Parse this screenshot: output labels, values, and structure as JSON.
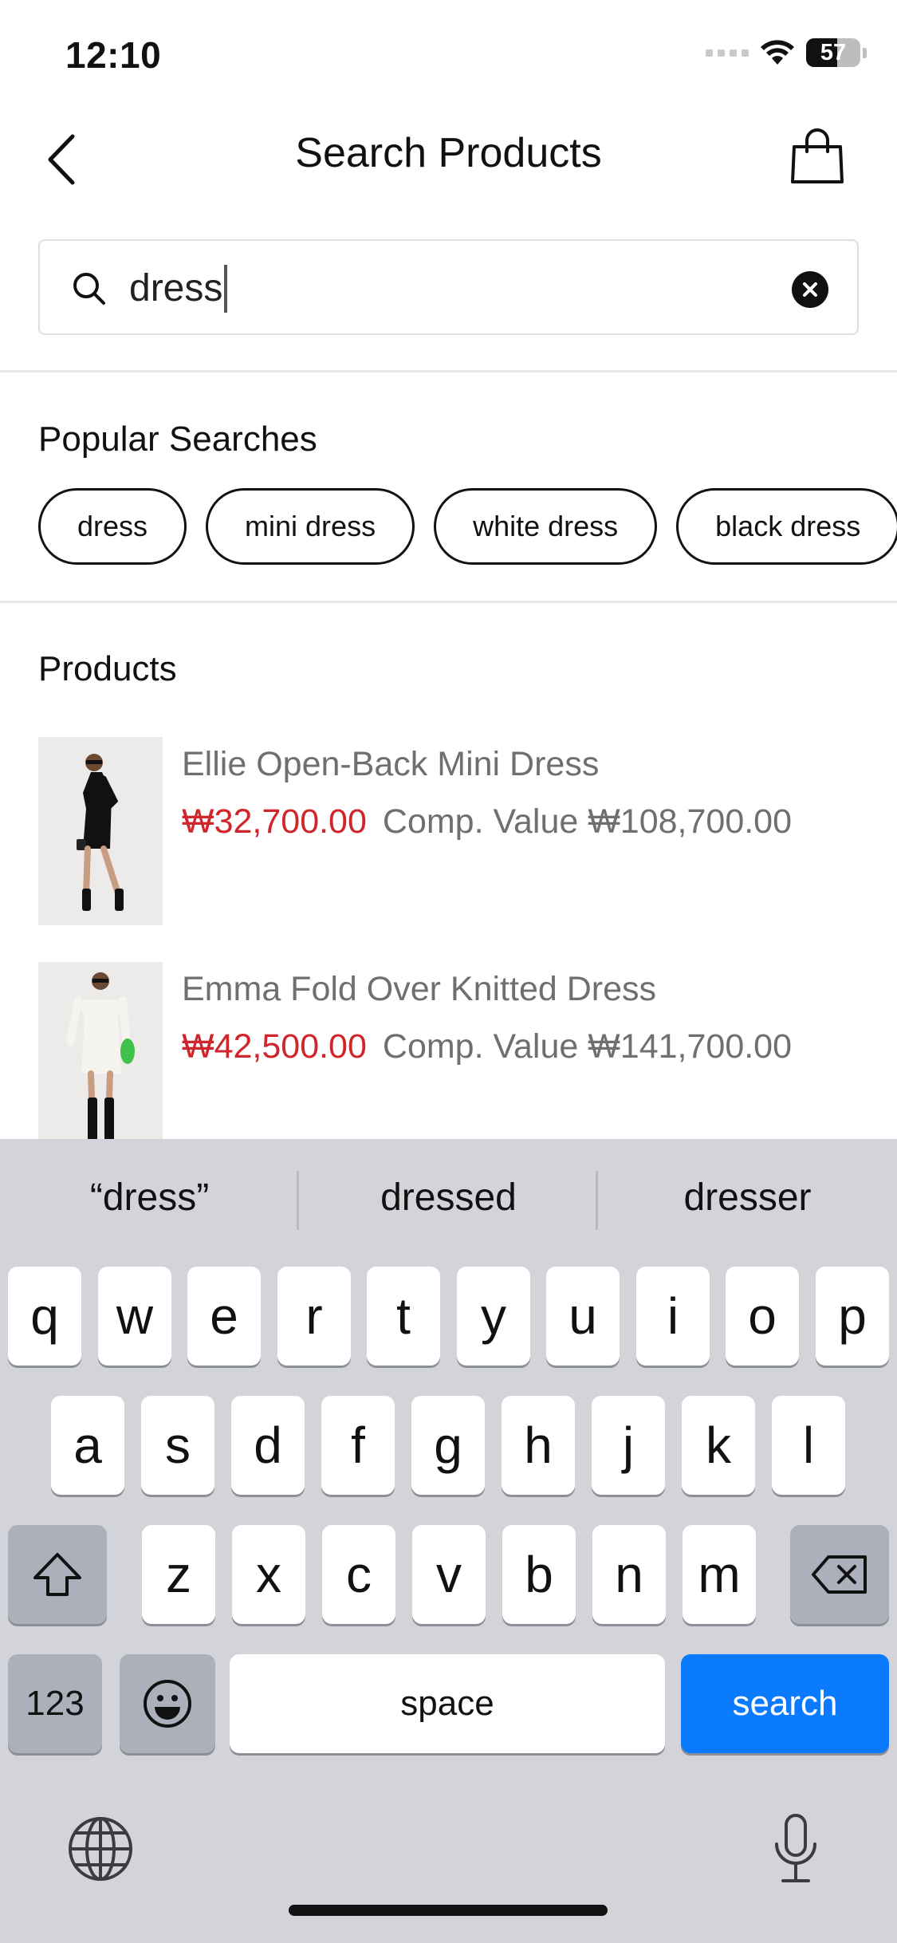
{
  "status_bar": {
    "time": "12:10",
    "battery": "57",
    "battery_level": 0.57
  },
  "nav": {
    "title": "Search Products"
  },
  "search": {
    "value": "dress",
    "placeholder": ""
  },
  "popular": {
    "title": "Popular Searches",
    "chips": [
      "dress",
      "mini dress",
      "white dress",
      "black dress"
    ]
  },
  "products": {
    "title": "Products",
    "items": [
      {
        "name": "Ellie Open-Back Mini Dress",
        "price": "₩32,700.00",
        "comp_value": "Comp. Value ₩108,700.00"
      },
      {
        "name": "Emma Fold Over Knitted Dress",
        "price": "₩42,500.00",
        "comp_value": "Comp. Value ₩141,700.00"
      }
    ]
  },
  "keyboard": {
    "suggestions": [
      "“dress”",
      "dressed",
      "dresser"
    ],
    "row1": [
      "q",
      "w",
      "e",
      "r",
      "t",
      "y",
      "u",
      "i",
      "o",
      "p"
    ],
    "row2": [
      "a",
      "s",
      "d",
      "f",
      "g",
      "h",
      "j",
      "k",
      "l"
    ],
    "row3": [
      "z",
      "x",
      "c",
      "v",
      "b",
      "n",
      "m"
    ],
    "numbers_label": "123",
    "space_label": "space",
    "search_label": "search"
  },
  "colors": {
    "accent_price": "#d0262b",
    "keyboard_search": "#0a7aff",
    "keyboard_bg": "#d2d4d9"
  }
}
